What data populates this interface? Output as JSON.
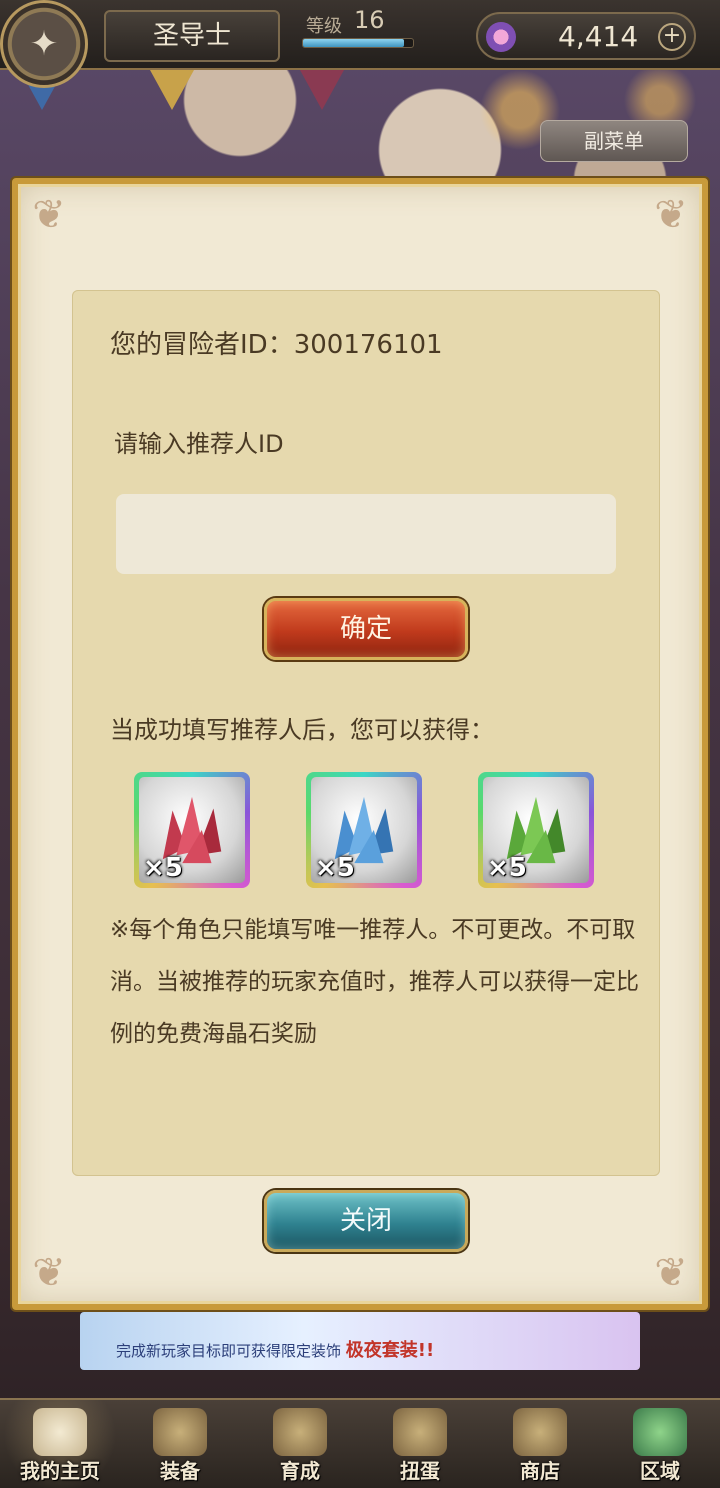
{
  "header": {
    "class_name": "圣导士",
    "level_label": "等级",
    "level": "16",
    "exp_progress": 0.92,
    "currency": "4,414",
    "submenu_label": "副菜单"
  },
  "dialog": {
    "adventurer_id": "您的冒险者ID：300176101",
    "prompt": "请输入推荐人ID",
    "input_value": "",
    "confirm_label": "确定",
    "reward_text": "当成功填写推荐人后，您可以获得：",
    "rewards": [
      {
        "icon": "red-crystal-icon",
        "color": "#c23a4e",
        "qty": "×5"
      },
      {
        "icon": "blue-crystal-icon",
        "color": "#4a8fd0",
        "qty": "×5"
      },
      {
        "icon": "green-crystal-icon",
        "color": "#5aa83a",
        "qty": "×5"
      }
    ],
    "note": "※每个角色只能填写唯一推荐人。不可更改。不可取消。当被推荐的玩家充值时，推荐人可以获得一定比例的免费海晶石奖励",
    "close_label": "关闭"
  },
  "banner": {
    "text": "完成新玩家目标即可获得限定装饰",
    "highlight": "极夜套装!!"
  },
  "nav": [
    {
      "label": "我的主页",
      "icon": "scroll-icon"
    },
    {
      "label": "装备",
      "icon": "helmet-icon"
    },
    {
      "label": "育成",
      "icon": "sword-icon"
    },
    {
      "label": "扭蛋",
      "icon": "capsule-icon"
    },
    {
      "label": "商店",
      "icon": "shop-icon"
    },
    {
      "label": "区域",
      "icon": "globe-icon"
    }
  ]
}
